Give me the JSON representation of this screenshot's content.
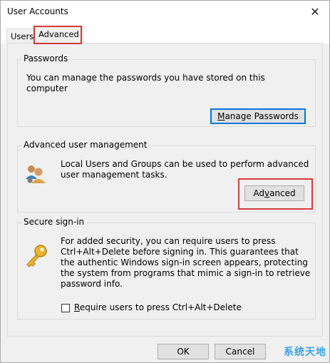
{
  "window": {
    "title": "User Accounts",
    "close_glyph": "✕"
  },
  "tabs": [
    {
      "label": "Users",
      "selected": false
    },
    {
      "label": "Advanced",
      "selected": true
    }
  ],
  "passwords": {
    "group_label": "Passwords",
    "description": "You can manage the passwords you have stored on this computer",
    "button": {
      "pre": "",
      "ul": "M",
      "post": "anage Passwords"
    }
  },
  "advanced_mgmt": {
    "group_label": "Advanced user management",
    "description": "Local Users and Groups can be used to perform advanced user management tasks.",
    "button": {
      "pre": "Ad",
      "ul": "v",
      "post": "anced"
    }
  },
  "secure_signin": {
    "group_label": "Secure sign-in",
    "description": "For added security, you can require users to press Ctrl+Alt+Delete before signing in. This guarantees that the authentic Windows sign-in screen appears, protecting the system from programs that mimic a sign-in to retrieve password info.",
    "checkbox": {
      "pre": "",
      "ul": "R",
      "post": "equire users to press Ctrl+Alt+Delete",
      "checked": false
    }
  },
  "footer": {
    "ok": "OK",
    "cancel": "Cancel"
  },
  "watermark": "系统天地",
  "colors": {
    "highlight": "#d33b3b",
    "focus": "#0078d7",
    "watermark": "#3aa3e6"
  }
}
